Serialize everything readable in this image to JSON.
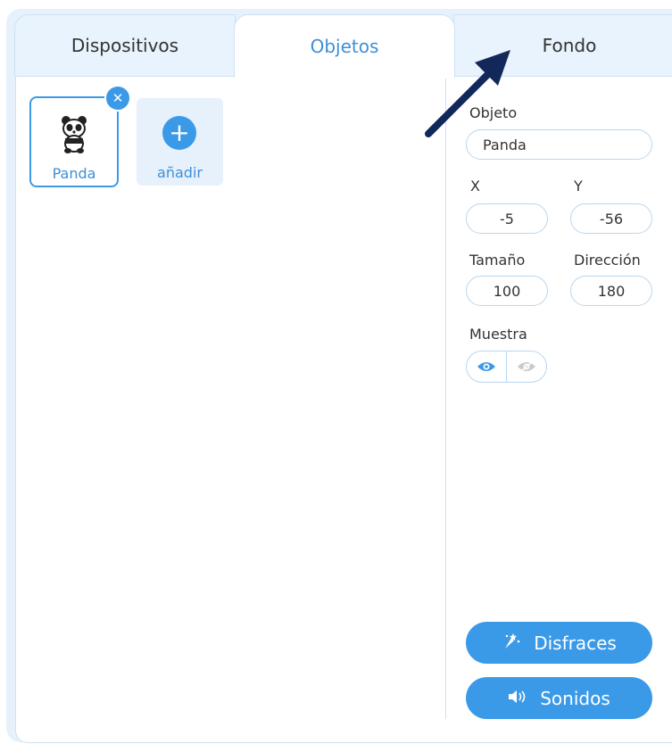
{
  "tabs": [
    {
      "label": "Dispositivos",
      "active": false
    },
    {
      "label": "Objetos",
      "active": true
    },
    {
      "label": "Fondo",
      "active": false
    }
  ],
  "sprites": {
    "items": [
      {
        "label": "Panda",
        "selected": true
      }
    ],
    "add_label": "añadir"
  },
  "properties": {
    "object_label": "Objeto",
    "object_value": "Panda",
    "x_label": "X",
    "x_value": "-5",
    "y_label": "Y",
    "y_value": "-56",
    "size_label": "Tamaño",
    "size_value": "100",
    "direction_label": "Dirección",
    "direction_value": "180",
    "show_label": "Muestra",
    "visible": true
  },
  "buttons": {
    "costumes_label": "Disfraces",
    "sounds_label": "Sonidos"
  },
  "icons": {
    "close": "close-icon",
    "add": "plus-icon",
    "show": "eye-icon",
    "hide": "eye-hidden-icon",
    "costumes": "costume-icon",
    "sounds": "speaker-icon"
  },
  "colors": {
    "accent": "#3b9ae8",
    "active_tab_text": "#3f8fd8",
    "annotation_arrow": "#13285a"
  }
}
